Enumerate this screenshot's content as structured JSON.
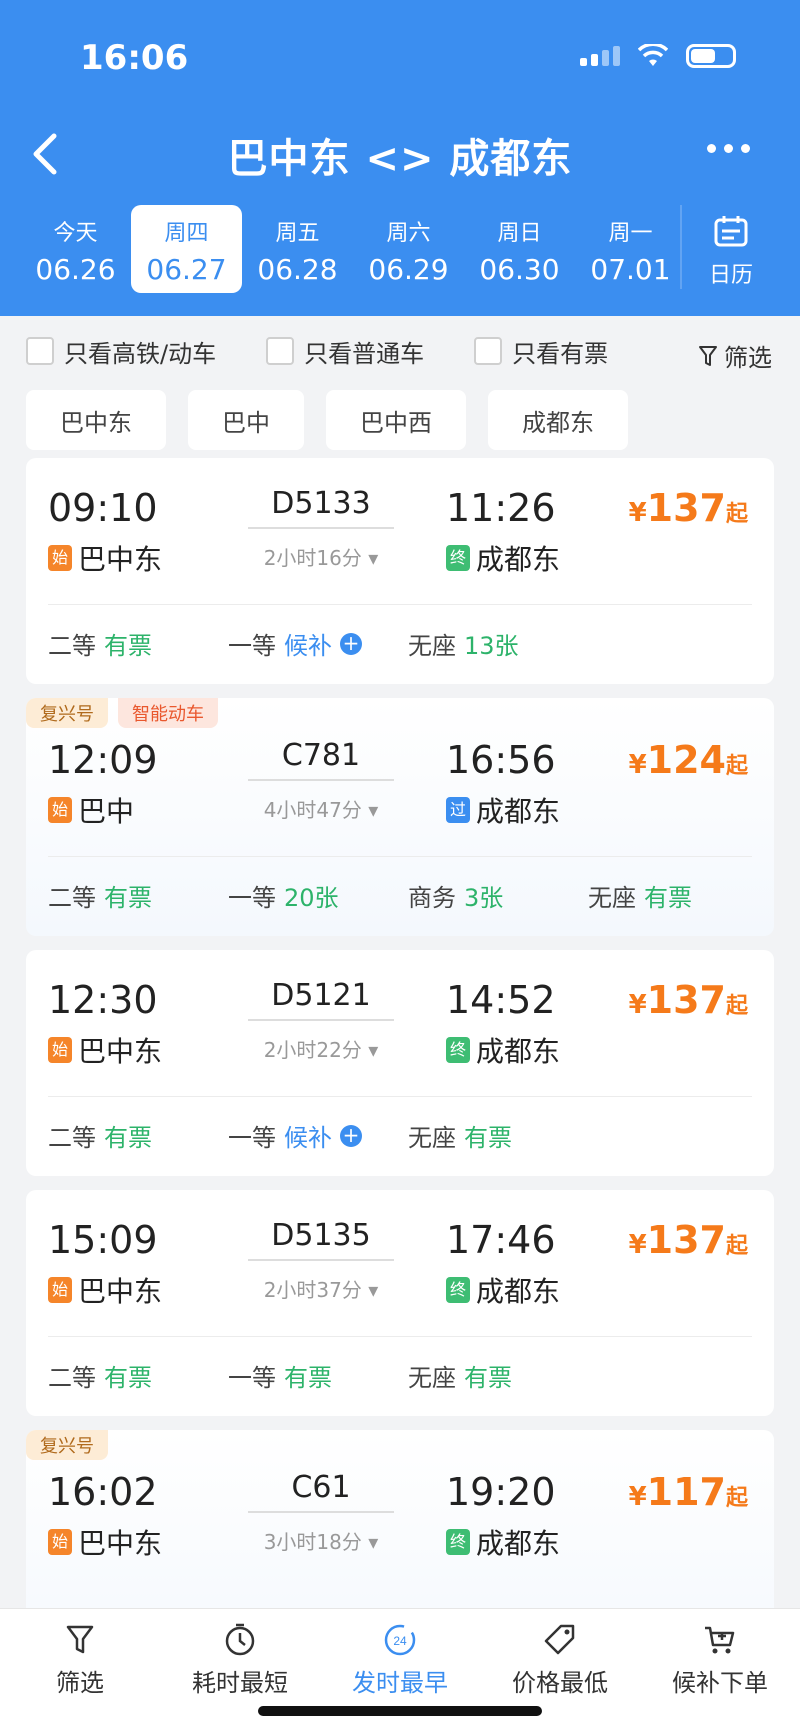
{
  "status_bar": {
    "time": "16:06"
  },
  "header": {
    "title": "巴中东 <> 成都东",
    "dates": [
      {
        "weekday": "今天",
        "date": "06.26",
        "active": false
      },
      {
        "weekday": "周四",
        "date": "06.27",
        "active": true
      },
      {
        "weekday": "周五",
        "date": "06.28",
        "active": false
      },
      {
        "weekday": "周六",
        "date": "06.29",
        "active": false
      },
      {
        "weekday": "周日",
        "date": "06.30",
        "active": false
      },
      {
        "weekday": "周一",
        "date": "07.01",
        "active": false
      }
    ],
    "calendar_label": "日历"
  },
  "filters": {
    "only_high_speed": "只看高铁/动车",
    "only_regular": "只看普通车",
    "only_available": "只看有票",
    "filter_label": "筛选"
  },
  "stations": [
    "巴中东",
    "巴中",
    "巴中西",
    "成都东"
  ],
  "trains": [
    {
      "tags": [],
      "depart_time": "09:10",
      "depart_station": "巴中东",
      "depart_badge": "始",
      "train_no": "D5133",
      "duration": "2小时16分",
      "arrive_time": "11:26",
      "arrive_station": "成都东",
      "arrive_badge": "终",
      "price": "137",
      "yen": "¥",
      "qi": "起",
      "seats": [
        {
          "cls": "二等",
          "status": "有票",
          "color": "green"
        },
        {
          "cls": "一等",
          "status": "候补",
          "color": "blue",
          "plus": true
        },
        {
          "cls": "无座",
          "status": "13张",
          "color": "green"
        }
      ]
    },
    {
      "tags": [
        "复兴号",
        "智能动车"
      ],
      "depart_time": "12:09",
      "depart_station": "巴中",
      "depart_badge": "始",
      "train_no": "C781",
      "duration": "4小时47分",
      "arrive_time": "16:56",
      "arrive_station": "成都东",
      "arrive_badge": "过",
      "price": "124",
      "yen": "¥",
      "qi": "起",
      "seats": [
        {
          "cls": "二等",
          "status": "有票",
          "color": "green"
        },
        {
          "cls": "一等",
          "status": "20张",
          "color": "green"
        },
        {
          "cls": "商务",
          "status": "3张",
          "color": "green"
        },
        {
          "cls": "无座",
          "status": "有票",
          "color": "green"
        }
      ]
    },
    {
      "tags": [],
      "depart_time": "12:30",
      "depart_station": "巴中东",
      "depart_badge": "始",
      "train_no": "D5121",
      "duration": "2小时22分",
      "arrive_time": "14:52",
      "arrive_station": "成都东",
      "arrive_badge": "终",
      "price": "137",
      "yen": "¥",
      "qi": "起",
      "seats": [
        {
          "cls": "二等",
          "status": "有票",
          "color": "green"
        },
        {
          "cls": "一等",
          "status": "候补",
          "color": "blue",
          "plus": true
        },
        {
          "cls": "无座",
          "status": "有票",
          "color": "green"
        }
      ]
    },
    {
      "tags": [],
      "depart_time": "15:09",
      "depart_station": "巴中东",
      "depart_badge": "始",
      "train_no": "D5135",
      "duration": "2小时37分",
      "arrive_time": "17:46",
      "arrive_station": "成都东",
      "arrive_badge": "终",
      "price": "137",
      "yen": "¥",
      "qi": "起",
      "seats": [
        {
          "cls": "二等",
          "status": "有票",
          "color": "green"
        },
        {
          "cls": "一等",
          "status": "有票",
          "color": "green"
        },
        {
          "cls": "无座",
          "status": "有票",
          "color": "green"
        }
      ]
    },
    {
      "tags": [
        "复兴号"
      ],
      "depart_time": "16:02",
      "depart_station": "巴中东",
      "depart_badge": "始",
      "train_no": "C61",
      "duration": "3小时18分",
      "arrive_time": "19:20",
      "arrive_station": "成都东",
      "arrive_badge": "终",
      "price": "117",
      "yen": "¥",
      "qi": "起",
      "seats": []
    }
  ],
  "tabbar": [
    {
      "label": "筛选",
      "icon": "filter-icon",
      "active": false
    },
    {
      "label": "耗时最短",
      "icon": "timer-icon",
      "active": false
    },
    {
      "label": "发时最早",
      "icon": "clock-24-icon",
      "active": true
    },
    {
      "label": "价格最低",
      "icon": "price-tag-icon",
      "active": false
    },
    {
      "label": "候补下单",
      "icon": "cart-icon",
      "active": false
    }
  ],
  "colors": {
    "primary": "#3b8ef0",
    "price": "#f57a1a",
    "available": "#2db36a"
  }
}
